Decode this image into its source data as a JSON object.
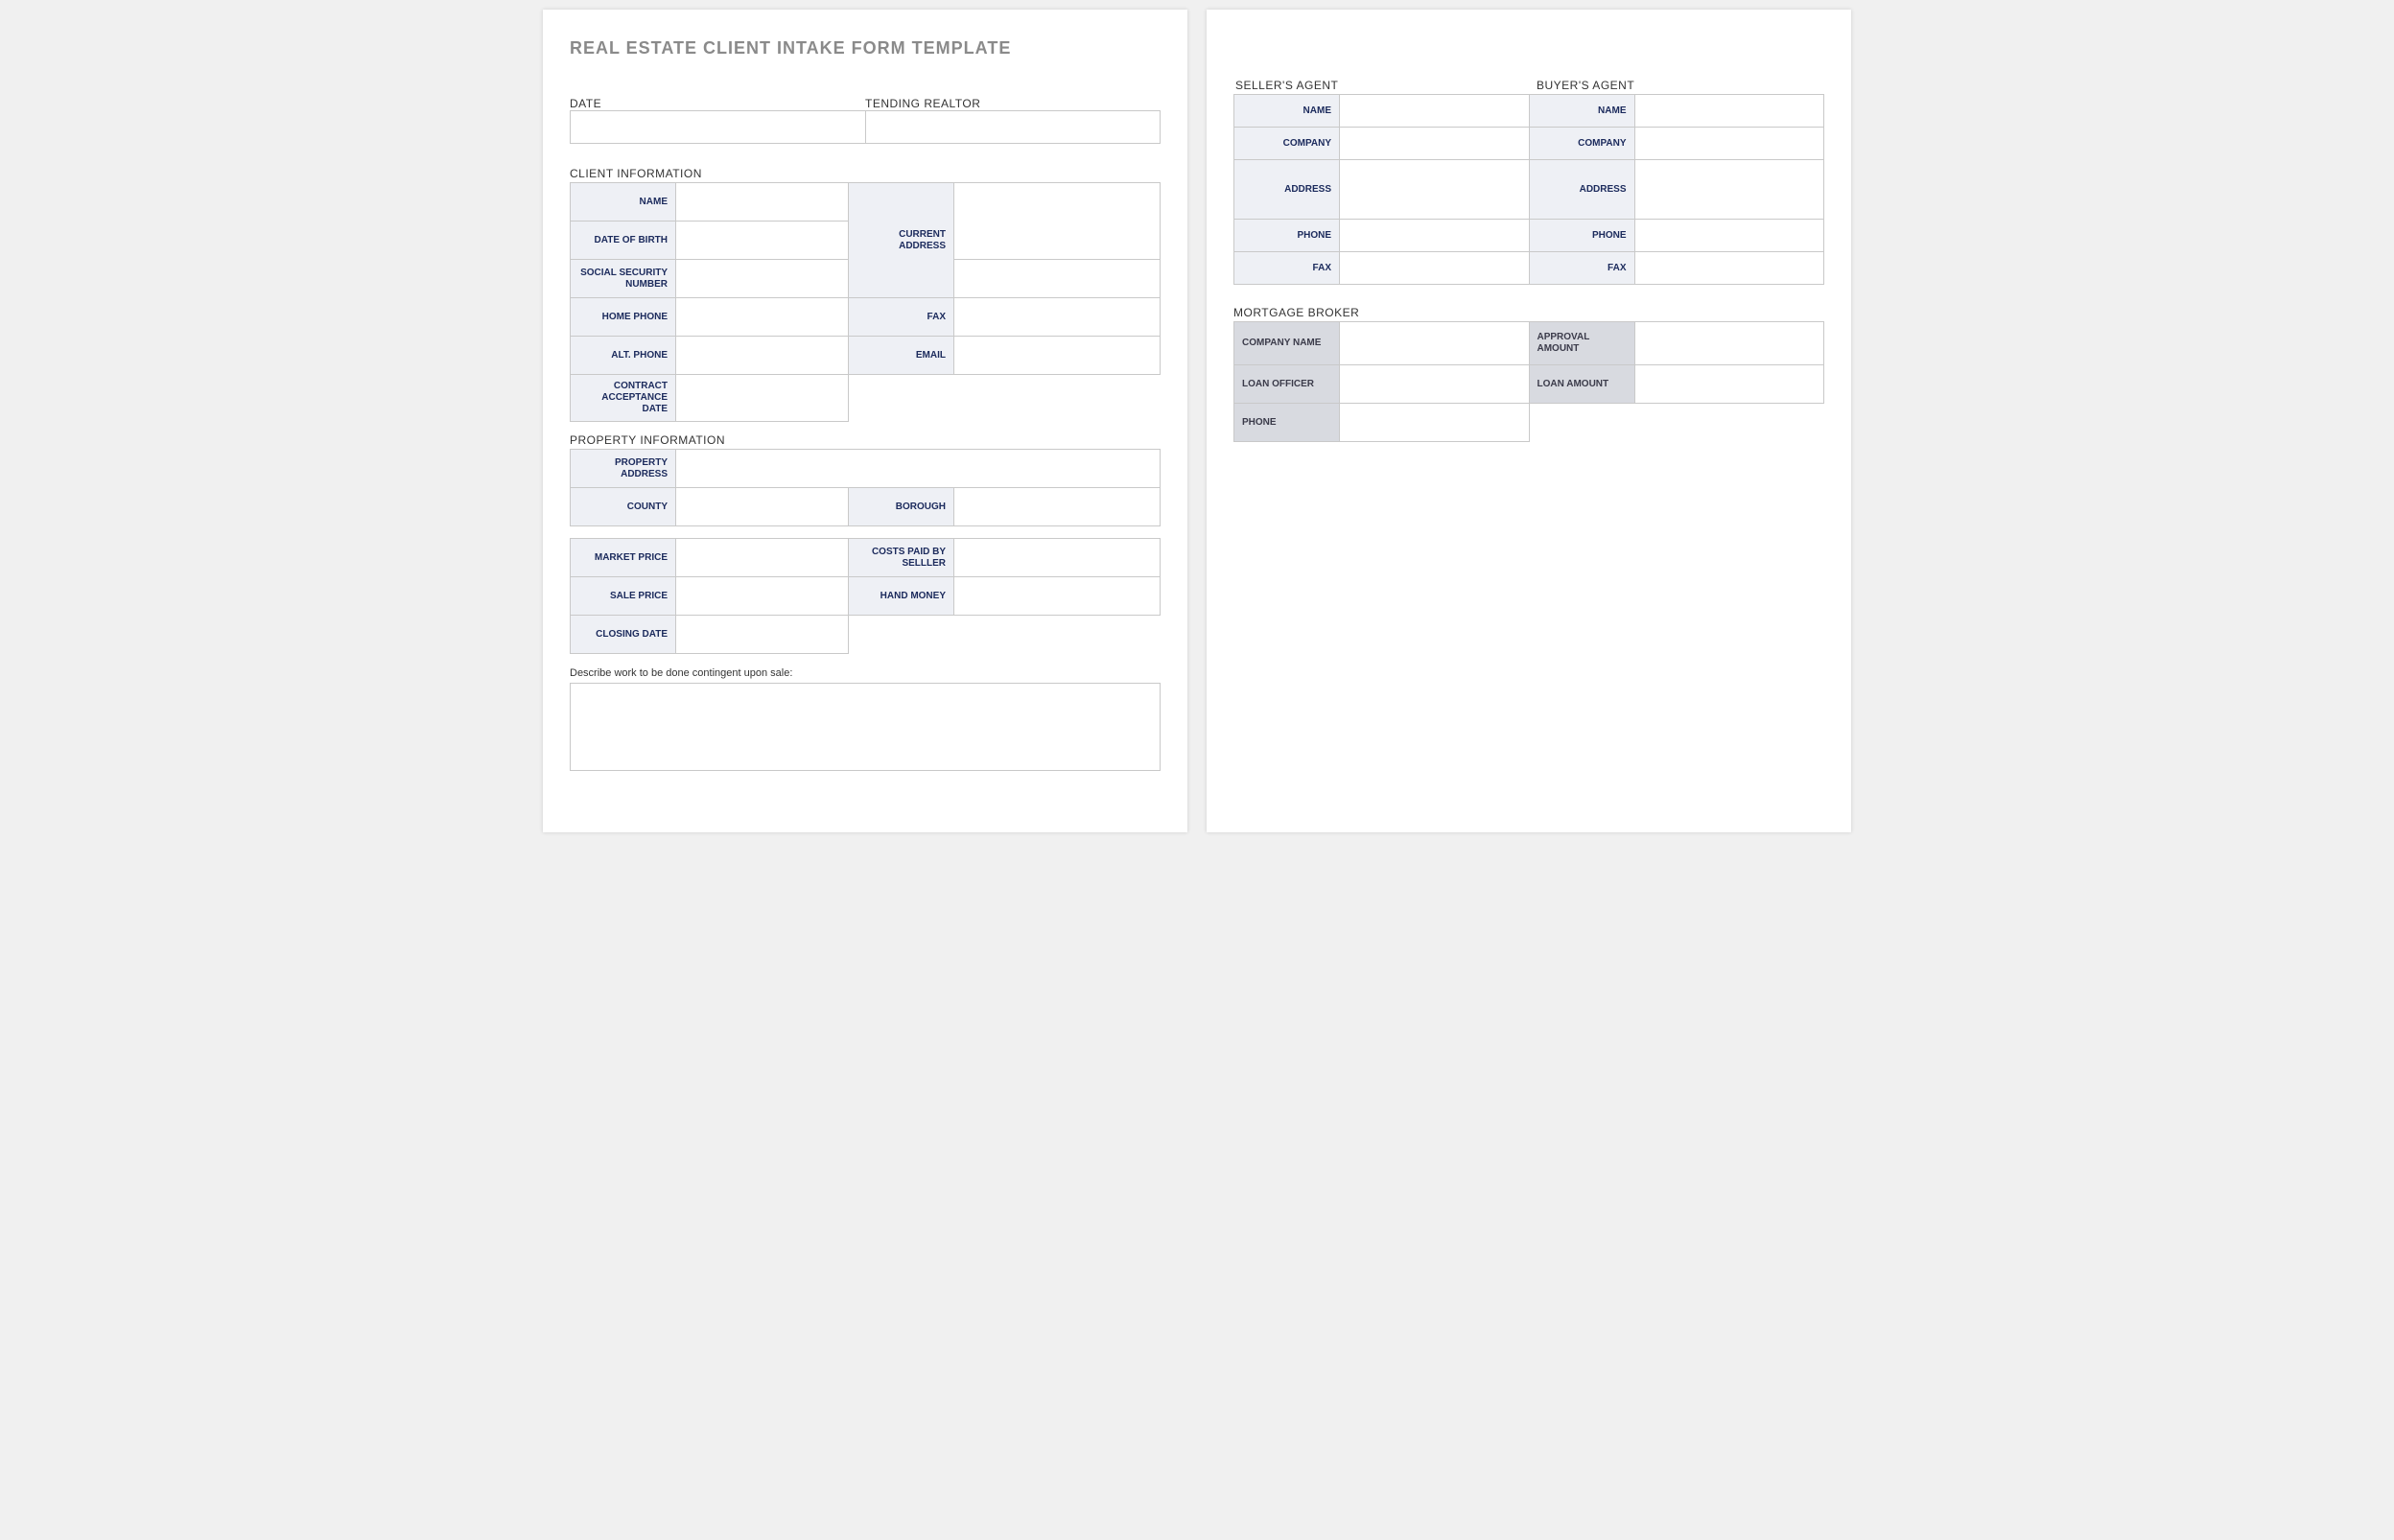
{
  "title": "REAL ESTATE CLIENT INTAKE FORM TEMPLATE",
  "top": {
    "date_label": "DATE",
    "realtor_label": "TENDING REALTOR"
  },
  "client": {
    "section": "CLIENT INFORMATION",
    "name": "NAME",
    "dob": "DATE OF BIRTH",
    "ssn": "SOCIAL SECURITY NUMBER",
    "home_phone": "HOME PHONE",
    "alt_phone": "ALT. PHONE",
    "contract_date": "CONTRACT ACCEPTANCE DATE",
    "current_address": "CURRENT ADDRESS",
    "fax": "FAX",
    "email": "EMAIL"
  },
  "property": {
    "section": "PROPERTY INFORMATION",
    "address": "PROPERTY ADDRESS",
    "county": "COUNTY",
    "borough": "BOROUGH",
    "market_price": "MARKET PRICE",
    "costs_paid": "COSTS PAID BY SELLLER",
    "sale_price": "SALE PRICE",
    "hand_money": "HAND MONEY",
    "closing_date": "CLOSING DATE"
  },
  "describe": "Describe work to be done contingent upon sale:",
  "agents": {
    "seller": "SELLER'S AGENT",
    "buyer": "BUYER'S AGENT",
    "name": "NAME",
    "company": "COMPANY",
    "address": "ADDRESS",
    "phone": "PHONE",
    "fax": "FAX"
  },
  "broker": {
    "section": "MORTGAGE BROKER",
    "company_name": "COMPANY NAME",
    "approval_amount": "APPROVAL AMOUNT",
    "loan_officer": "LOAN OFFICER",
    "loan_amount": "LOAN AMOUNT",
    "phone": "PHONE"
  }
}
